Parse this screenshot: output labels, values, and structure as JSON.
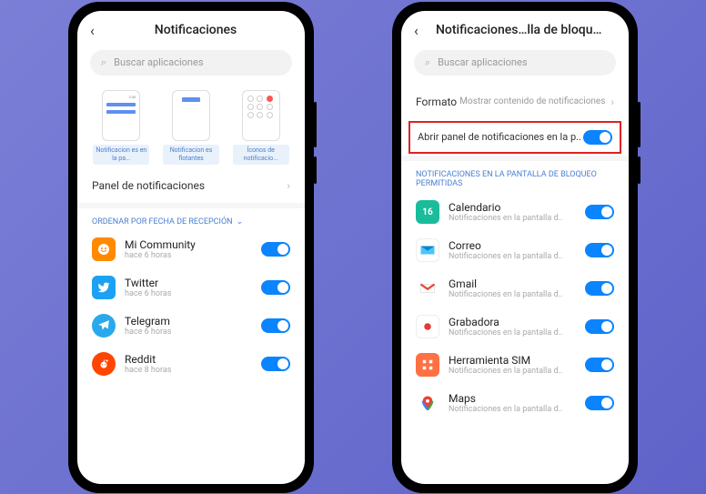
{
  "left": {
    "title": "Notificaciones",
    "search_placeholder": "Buscar aplicaciones",
    "options": [
      {
        "label": "Notificacion\nes en la pa..."
      },
      {
        "label": "Notificacion\nes flotantes"
      },
      {
        "label": "Íconos de\nnotificacio..."
      }
    ],
    "panel_link": "Panel de notificaciones",
    "section_label": "ORDENAR POR FECHA DE RECEPCIÓN",
    "apps": [
      {
        "name": "Mi Community",
        "sub": "hace 6 horas",
        "icon": "mi",
        "enabled": true
      },
      {
        "name": "Twitter",
        "sub": "hace 6 horas",
        "icon": "twitter",
        "enabled": true
      },
      {
        "name": "Telegram",
        "sub": "hace 6 horas",
        "icon": "telegram",
        "enabled": true
      },
      {
        "name": "Reddit",
        "sub": "hace 8 horas",
        "icon": "reddit",
        "enabled": true
      }
    ]
  },
  "right": {
    "title": "Notificaciones…lla de bloqueo",
    "search_placeholder": "Buscar aplicaciones",
    "format_label": "Formato",
    "format_value": "Mostrar contenido de notificaciones",
    "highlight_label": "Abrir panel de notificaciones en la p..",
    "section_label": "NOTIFICACIONES EN LA PANTALLA DE BLOQUEO PERMITIDAS",
    "apps": [
      {
        "name": "Calendario",
        "sub": "Notificaciones en la pantalla d..",
        "icon": "cal",
        "badge": "16",
        "enabled": true
      },
      {
        "name": "Correo",
        "sub": "Notificaciones en la pantalla d..",
        "icon": "correo",
        "enabled": true
      },
      {
        "name": "Gmail",
        "sub": "Notificaciones en la pantalla d..",
        "icon": "gmail",
        "enabled": true
      },
      {
        "name": "Grabadora",
        "sub": "Notificaciones en la pantalla d..",
        "icon": "rec",
        "enabled": true
      },
      {
        "name": "Herramienta SIM",
        "sub": "Notificaciones en la pantalla d..",
        "icon": "sim",
        "enabled": true
      },
      {
        "name": "Maps",
        "sub": "Notificaciones en la pantalla d..",
        "icon": "maps",
        "enabled": true
      }
    ]
  }
}
